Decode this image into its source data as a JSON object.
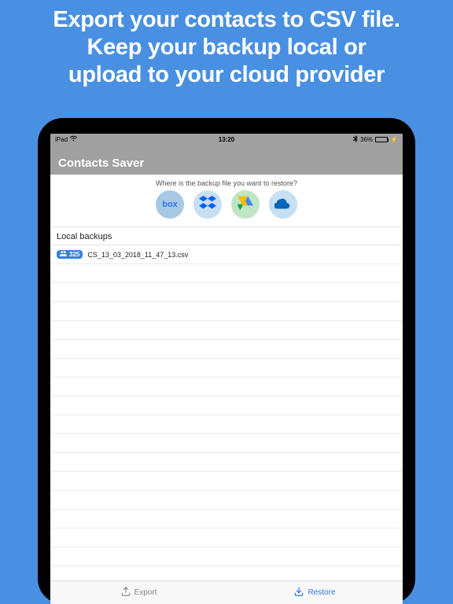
{
  "promo": {
    "line1": "Export your contacts to CSV file.",
    "line2": "Keep your backup local or",
    "line3": "upload to your cloud provider"
  },
  "statusbar": {
    "device": "iPad",
    "time": "13:20",
    "battery_percent": "36%"
  },
  "navbar": {
    "title": "Contacts Saver"
  },
  "restore": {
    "question": "Where is the backup file you want to restore?",
    "providers": [
      "box",
      "dropbox",
      "google-drive",
      "onedrive"
    ]
  },
  "local": {
    "header": "Local backups",
    "items": [
      {
        "count": "325",
        "filename": "CS_13_03_2018_11_47_13.csv"
      }
    ]
  },
  "tabs": {
    "export": "Export",
    "restore": "Restore"
  }
}
